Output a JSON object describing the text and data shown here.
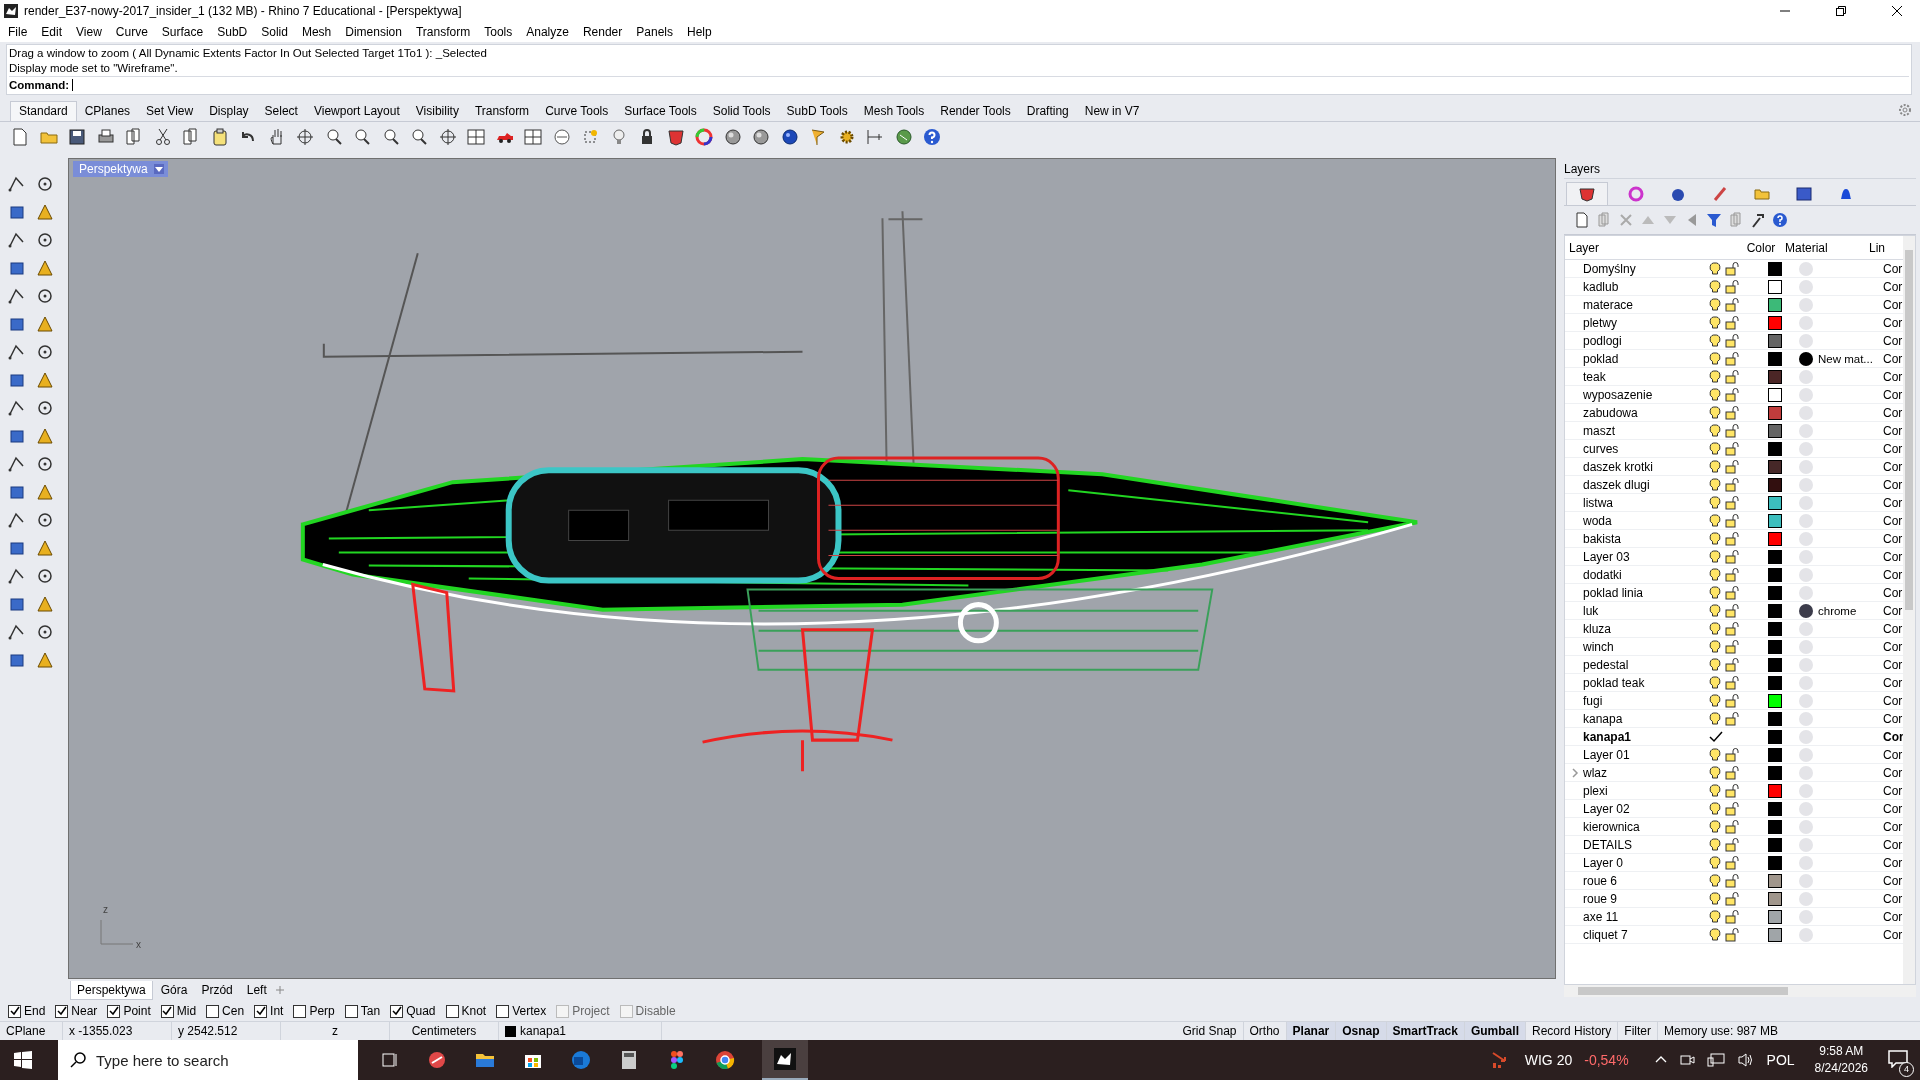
{
  "window": {
    "title": "render_E37-nowy-2017_insider_1 (132 MB) - Rhino 7 Educational - [Perspektywa]"
  },
  "menu": [
    "File",
    "Edit",
    "View",
    "Curve",
    "Surface",
    "SubD",
    "Solid",
    "Mesh",
    "Dimension",
    "Transform",
    "Tools",
    "Analyze",
    "Render",
    "Panels",
    "Help"
  ],
  "command_history": [
    "Drag a window to zoom ( All  Dynamic  Extents  Factor  In  Out  Selected  Target  1To1 ): _Selected",
    "Display mode set to \"Wireframe\"."
  ],
  "command": {
    "label": "Command:"
  },
  "toolbar_tabs": [
    {
      "label": "Standard",
      "selected": true
    },
    {
      "label": "CPlanes",
      "selected": false
    },
    {
      "label": "Set View",
      "selected": false
    },
    {
      "label": "Display",
      "selected": false
    },
    {
      "label": "Select",
      "selected": false
    },
    {
      "label": "Viewport Layout",
      "selected": false
    },
    {
      "label": "Visibility",
      "selected": false
    },
    {
      "label": "Transform",
      "selected": false
    },
    {
      "label": "Curve Tools",
      "selected": false
    },
    {
      "label": "Surface Tools",
      "selected": false
    },
    {
      "label": "Solid Tools",
      "selected": false
    },
    {
      "label": "SubD Tools",
      "selected": false
    },
    {
      "label": "Mesh Tools",
      "selected": false
    },
    {
      "label": "Render Tools",
      "selected": false
    },
    {
      "label": "Drafting",
      "selected": false
    },
    {
      "label": "New in V7",
      "selected": false
    }
  ],
  "viewport": {
    "title": "Perspektywa",
    "axes": [
      "z",
      "x"
    ]
  },
  "viewport_tabs": [
    {
      "label": "Perspektywa",
      "selected": true
    },
    {
      "label": "Góra",
      "selected": false
    },
    {
      "label": "Przód",
      "selected": false
    },
    {
      "label": "Left",
      "selected": false
    }
  ],
  "layers_panel": {
    "title": "Layers",
    "tabs": [
      {
        "selected": true
      },
      {
        "selected": false
      },
      {
        "selected": false
      },
      {
        "selected": false
      },
      {
        "selected": false
      },
      {
        "selected": false
      },
      {
        "selected": false
      }
    ],
    "columns": [
      "Layer",
      "Color",
      "Material",
      "Lin"
    ],
    "rows": [
      {
        "name": "Domyślny",
        "color": "#000000",
        "linetype": "Cor",
        "current": false
      },
      {
        "name": "kadlub",
        "color": "#ffffff",
        "linetype": "Cor",
        "current": false
      },
      {
        "name": "materace",
        "color": "#3cba78",
        "linetype": "Cor",
        "current": false
      },
      {
        "name": "pletwy",
        "color": "#ff0000",
        "linetype": "Cor",
        "current": false
      },
      {
        "name": "podlogi",
        "color": "#646464",
        "linetype": "Cor",
        "current": false
      },
      {
        "name": "poklad",
        "color": "#000000",
        "material": {
          "name": "New mat...",
          "color": "#000000"
        },
        "linetype": "Cor",
        "current": false
      },
      {
        "name": "teak",
        "color": "#4b2626",
        "linetype": "Cor",
        "current": false
      },
      {
        "name": "wyposazenie",
        "color": "#ffffff",
        "linetype": "Cor",
        "current": false
      },
      {
        "name": "zabudowa",
        "color": "#c03c3c",
        "linetype": "Cor",
        "current": false
      },
      {
        "name": "maszt",
        "color": "#646464",
        "linetype": "Cor",
        "current": false
      },
      {
        "name": "curves",
        "color": "#000000",
        "linetype": "Cor",
        "current": false
      },
      {
        "name": "daszek krotki",
        "color": "#462828",
        "linetype": "Cor",
        "current": false
      },
      {
        "name": "daszek dlugi",
        "color": "#320f0f",
        "linetype": "Cor",
        "current": false
      },
      {
        "name": "listwa",
        "color": "#3cbebe",
        "linetype": "Cor",
        "current": false
      },
      {
        "name": "woda",
        "color": "#3cbebe",
        "linetype": "Cor",
        "current": false
      },
      {
        "name": "bakista",
        "color": "#ff0000",
        "linetype": "Cor",
        "current": false
      },
      {
        "name": "Layer 03",
        "color": "#000000",
        "linetype": "Cor",
        "current": false
      },
      {
        "name": "dodatki",
        "color": "#000000",
        "linetype": "Cor",
        "current": false
      },
      {
        "name": "poklad linia",
        "color": "#000000",
        "linetype": "Cor",
        "current": false
      },
      {
        "name": "luk",
        "color": "#000000",
        "material": {
          "name": "chrome",
          "color": "#3c3c4b"
        },
        "linetype": "Cor",
        "current": false
      },
      {
        "name": "kluza",
        "color": "#000000",
        "linetype": "Cor",
        "current": false
      },
      {
        "name": "winch",
        "color": "#000000",
        "linetype": "Cor",
        "current": false
      },
      {
        "name": "pedestal",
        "color": "#000000",
        "linetype": "Cor",
        "current": false
      },
      {
        "name": "poklad teak",
        "color": "#000000",
        "linetype": "Cor",
        "current": false
      },
      {
        "name": "fugi",
        "color": "#00ff00",
        "linetype": "Cor",
        "current": false
      },
      {
        "name": "kanapa",
        "color": "#000000",
        "linetype": "Cor",
        "current": false
      },
      {
        "name": "kanapa1",
        "color": "#000000",
        "linetype": "Cor",
        "current": true
      },
      {
        "name": "Layer 01",
        "color": "#000000",
        "linetype": "Cor",
        "current": false
      },
      {
        "name": "wlaz",
        "color": "#000000",
        "linetype": "Cor",
        "current": false,
        "expanded": false
      },
      {
        "name": "plexi",
        "color": "#ff0000",
        "linetype": "Cor",
        "current": false
      },
      {
        "name": "Layer 02",
        "color": "#000000",
        "linetype": "Cor",
        "current": false
      },
      {
        "name": "kierownica",
        "color": "#000000",
        "linetype": "Cor",
        "current": false
      },
      {
        "name": "DETAILS",
        "color": "#000000",
        "linetype": "Cor",
        "current": false
      },
      {
        "name": "Layer 0",
        "color": "#000000",
        "linetype": "Cor",
        "current": false
      },
      {
        "name": "roue 6",
        "color": "#a0968c",
        "linetype": "Cor",
        "current": false
      },
      {
        "name": "roue 9",
        "color": "#a0968c",
        "linetype": "Cor",
        "current": false
      },
      {
        "name": "axe 11",
        "color": "#a0a5a8",
        "linetype": "Cor",
        "current": false
      },
      {
        "name": "cliquet 7",
        "color": "#a0a5a8",
        "linetype": "Cor",
        "current": false
      }
    ]
  },
  "osnaps": [
    {
      "label": "End",
      "checked": true,
      "disabled": false
    },
    {
      "label": "Near",
      "checked": true,
      "disabled": false
    },
    {
      "label": "Point",
      "checked": true,
      "disabled": false
    },
    {
      "label": "Mid",
      "checked": true,
      "disabled": false
    },
    {
      "label": "Cen",
      "checked": false,
      "disabled": false
    },
    {
      "label": "Int",
      "checked": true,
      "disabled": false
    },
    {
      "label": "Perp",
      "checked": false,
      "disabled": false
    },
    {
      "label": "Tan",
      "checked": false,
      "disabled": false
    },
    {
      "label": "Quad",
      "checked": true,
      "disabled": false
    },
    {
      "label": "Knot",
      "checked": false,
      "disabled": false
    },
    {
      "label": "Vertex",
      "checked": false,
      "disabled": false
    },
    {
      "label": "Project",
      "checked": false,
      "disabled": true
    },
    {
      "label": "Disable",
      "checked": false,
      "disabled": true
    }
  ],
  "status_bar": {
    "cplane": "CPlane",
    "x": "x -1355.023",
    "y": "y 2542.512",
    "z": "z",
    "units": "Centimeters",
    "layer": {
      "name": "kanapa1",
      "color": "#000000"
    },
    "toggles": [
      {
        "label": "Grid Snap",
        "on": false
      },
      {
        "label": "Ortho",
        "on": false
      },
      {
        "label": "Planar",
        "on": true
      },
      {
        "label": "Osnap",
        "on": true
      },
      {
        "label": "SmartTrack",
        "on": true
      },
      {
        "label": "Gumball",
        "on": true
      },
      {
        "label": "Record History",
        "on": false
      },
      {
        "label": "Filter",
        "on": false
      }
    ],
    "memory": "Memory use: 987 MB"
  },
  "taskbar": {
    "search": {
      "placeholder": "Type here to search"
    },
    "ticker": {
      "name": "WIG 20",
      "change": "-0,54%"
    },
    "language": "POL",
    "time": "9:58 AM",
    "date": "8/24/2026",
    "notifications": "4"
  }
}
